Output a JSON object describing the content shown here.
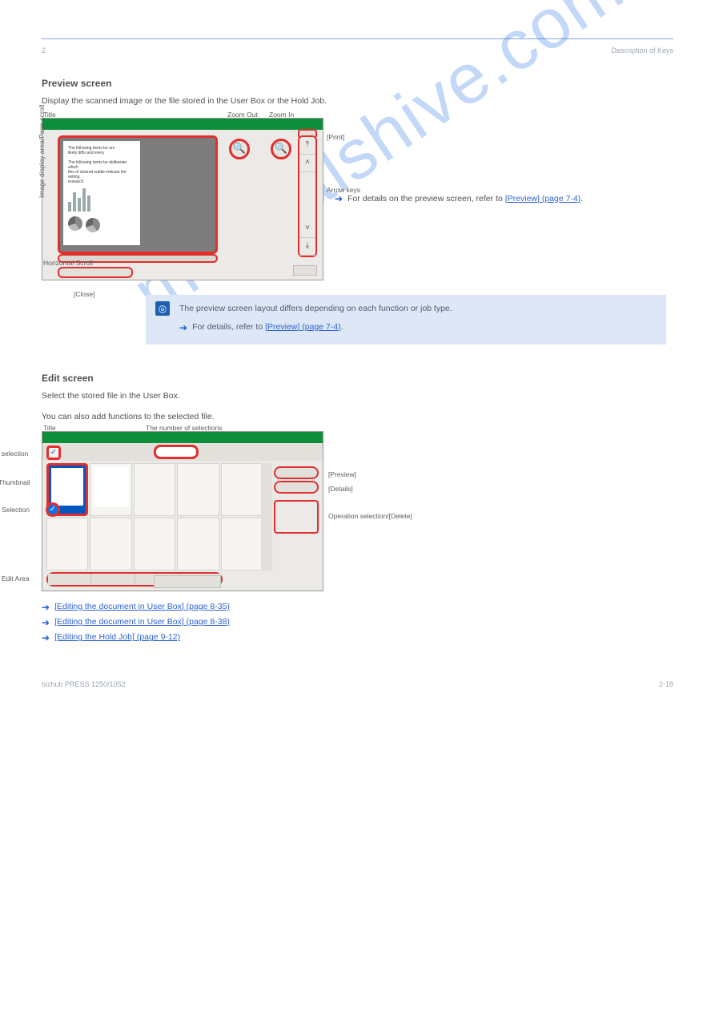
{
  "header": {
    "left": "2",
    "right": "Description of Keys"
  },
  "watermark": "manualshive.com",
  "sec1": {
    "h2": "Preview screen",
    "lead": "Display the scanned image or the file stored in the User Box or the Hold Job.",
    "caption_title": "Title",
    "caption_canvas": "Image display area/Page scroll",
    "caption_hscroll": "Horizontal Scroll",
    "caption_close": "[Close]",
    "caption_zoomout": "Zoom Out",
    "caption_zoomin": "Zoom In",
    "caption_pager": "Arrow keys",
    "caption_print": "[Print]",
    "side_text": "For details on the preview screen, refer to",
    "side_link": "[Preview] (page 7-4)"
  },
  "info": {
    "line1": "The preview screen layout differs depending on each function or job type.",
    "line2_pre": "For details, refer to ",
    "line2_link": "[Preview] (page 7-4)"
  },
  "sec2": {
    "h2": "Edit screen",
    "lead_a": "Select the stored file in the User Box.",
    "lead_b": "You can also add functions to the selected file.",
    "caption_title": "Title",
    "caption_allsel": "All selection",
    "caption_count": "The number of selections",
    "caption_thumb": "Thumbnail",
    "caption_sel": "Selection",
    "caption_edit": "Edit Area",
    "caption_preview": "[Preview]",
    "caption_detail": "[Details]",
    "caption_delsel": "Operation selection/[Delete]"
  },
  "refs": {
    "r1": "[Editing the document in User Box] (page 8-35)",
    "r2": "[Editing the document in User Box] (page 8-38)",
    "r3": "[Editing the Hold Job] (page 9-12)"
  },
  "footer": {
    "left": "bizhub PRESS 1250/1052",
    "right": "2-18"
  }
}
